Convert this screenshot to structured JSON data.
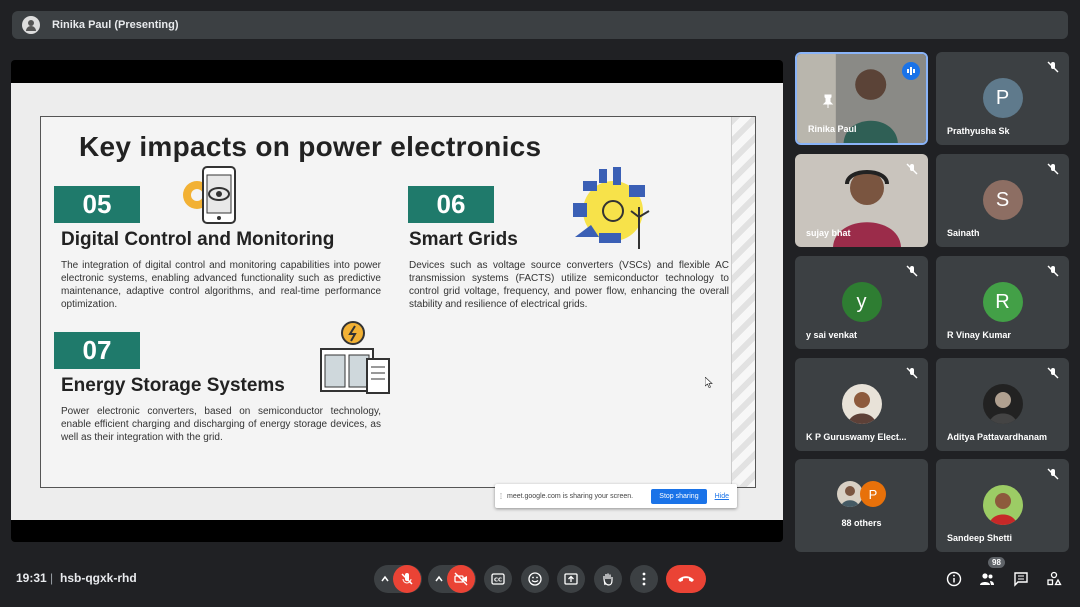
{
  "presenter": {
    "label": "Rinika Paul (Presenting)"
  },
  "slide": {
    "title": "Key impacts on power electronics",
    "sections": [
      {
        "number": "05",
        "title": "Digital Control and Monitoring",
        "body": "The integration of digital control and monitoring capabilities into power electronic systems, enabling advanced functionality such as predictive maintenance, adaptive control algorithms, and real-time performance optimization."
      },
      {
        "number": "06",
        "title": "Smart Grids",
        "body": "Devices such as voltage source converters (VSCs) and flexible AC transmission systems (FACTS) utilize semiconductor technology to control grid voltage, frequency, and power flow, enhancing the overall stability and resilience of electrical grids."
      },
      {
        "number": "07",
        "title": "Energy Storage Systems",
        "body": "Power electronic converters, based on semiconductor technology, enable efficient charging and discharging of energy storage devices, as well as their integration with the grid."
      }
    ],
    "accent_color": "#1f7a6b"
  },
  "share_banner": {
    "text": "meet.google.com is sharing your screen.",
    "stop_label": "Stop sharing",
    "hide_label": "Hide"
  },
  "participants": [
    {
      "name": "Rinika Paul",
      "kind": "video",
      "active": true
    },
    {
      "name": "Prathyusha Sk",
      "kind": "letter",
      "letter": "P",
      "color": "#5f7a8c",
      "muted": true
    },
    {
      "name": "sujay bhat",
      "kind": "video",
      "muted": true
    },
    {
      "name": "Sainath",
      "kind": "letter",
      "letter": "S",
      "color": "#8d6e63",
      "muted": true
    },
    {
      "name": "y sai venkat",
      "kind": "letter",
      "letter": "y",
      "color": "#2e7d32",
      "muted": true
    },
    {
      "name": "R Vinay Kumar",
      "kind": "letter",
      "letter": "R",
      "color": "#43a047",
      "muted": true
    },
    {
      "name": "K P Guruswamy Elect...",
      "kind": "photo",
      "muted": true
    },
    {
      "name": "Aditya Pattavardhanam",
      "kind": "photo",
      "muted": true
    },
    {
      "name": "88 others",
      "kind": "others",
      "letter": "P"
    },
    {
      "name": "Sandeep Shetti",
      "kind": "photo",
      "muted": true
    }
  ],
  "bottom_bar": {
    "time": "19:31",
    "separator": "|",
    "meeting_code": "hsb-qgxk-rhd",
    "participant_count": "98"
  },
  "colors": {
    "background": "#202124",
    "tile": "#3c4043",
    "danger": "#ea4335",
    "active_border": "#8ab4f8"
  }
}
